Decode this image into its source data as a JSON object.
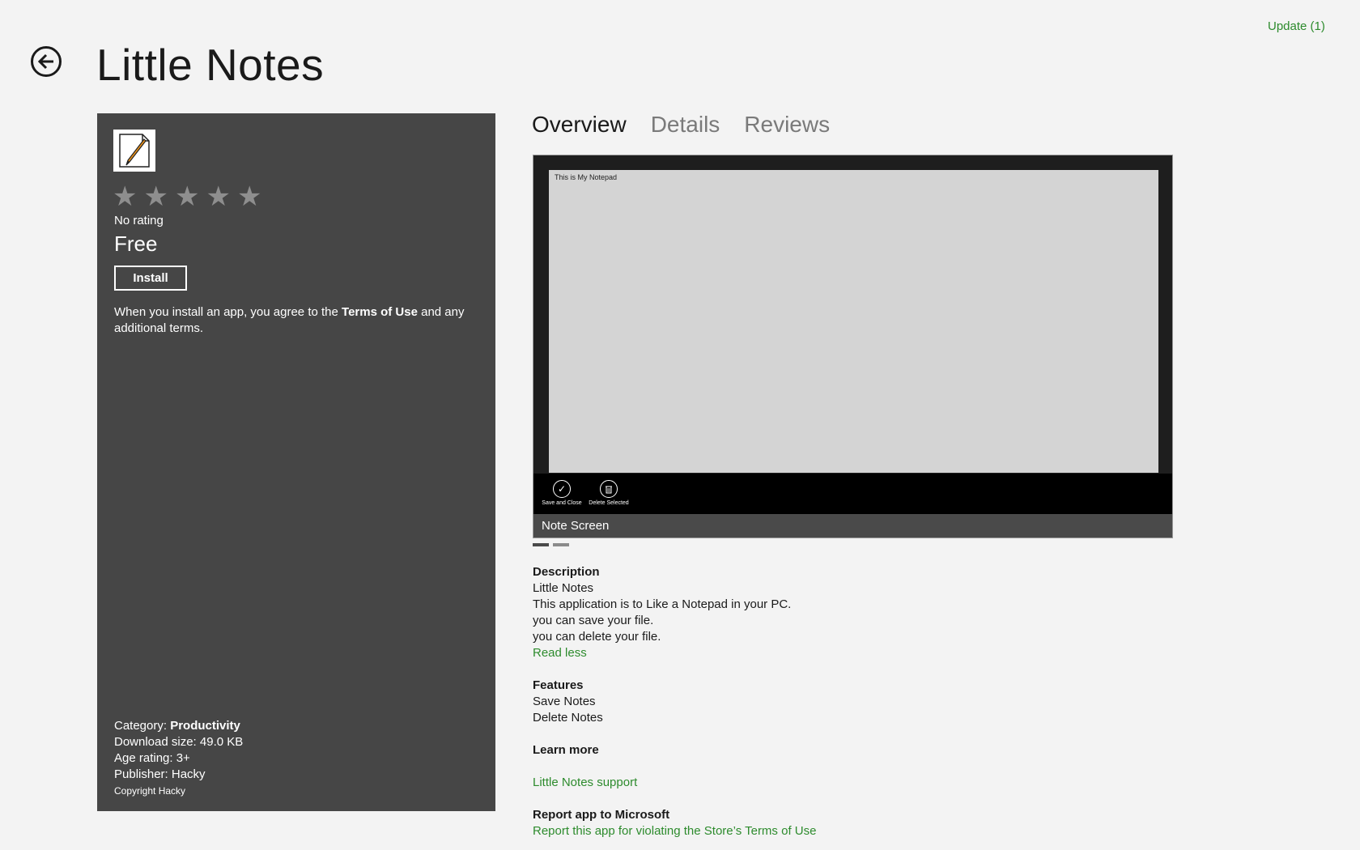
{
  "header": {
    "update_label": "Update (1)",
    "title": "Little Notes"
  },
  "app_panel": {
    "rating_text": "No rating",
    "price": "Free",
    "install_label": "Install",
    "terms_prefix": "When you install an app, you agree to the ",
    "terms_link": "Terms of Use",
    "terms_suffix": " and any additional terms.",
    "meta": {
      "category_label": "Category: ",
      "category_value": "Productivity",
      "download_size": "Download size: 49.0 KB",
      "age_rating": "Age rating: 3+",
      "publisher": "Publisher: Hacky",
      "copyright": "Copyright Hacky"
    }
  },
  "tabs": [
    {
      "label": "Overview"
    },
    {
      "label": "Details"
    },
    {
      "label": "Reviews"
    }
  ],
  "screenshot": {
    "inner_heading": "This is My Notepad",
    "app_bar_buttons": [
      {
        "label": "Save and Close",
        "icon": "check-icon"
      },
      {
        "label": "Delete Selected",
        "icon": "trash-icon"
      }
    ],
    "caption": "Note Screen"
  },
  "description": {
    "heading": "Description",
    "lines": [
      "Little Notes",
      "This application is to Like a Notepad in your PC.",
      "you can save your file.",
      "you can delete your file."
    ],
    "read_less": "Read less"
  },
  "features": {
    "heading": "Features",
    "items": [
      "Save Notes",
      "Delete Notes"
    ]
  },
  "learn_more": {
    "heading": "Learn more",
    "support_link": "Little Notes support"
  },
  "report": {
    "heading": "Report app to Microsoft",
    "link": "Report this app for violating the Store’s Terms of Use"
  },
  "colors": {
    "accent_link": "#2d8b2d",
    "panel_bg": "#464646",
    "page_bg": "#f3f3f3"
  }
}
